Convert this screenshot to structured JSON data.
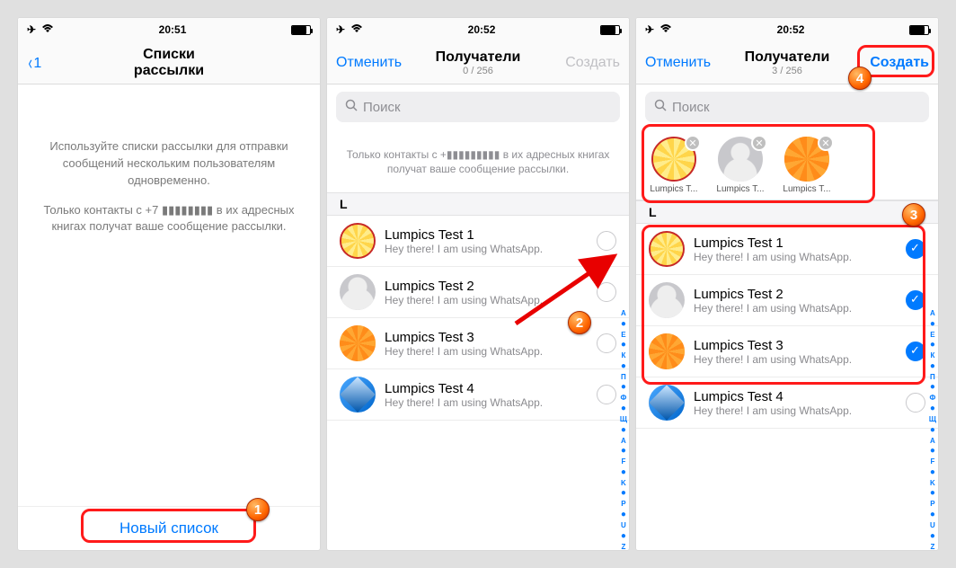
{
  "status": {
    "time1": "20:51",
    "time2": "20:52",
    "time3": "20:52"
  },
  "screen1": {
    "back_label": "1",
    "title": "Списки рассылки",
    "intro1": "Используйте списки рассылки для отправки сообщений нескольким пользователям одновременно.",
    "intro2": "Только контакты с +7 ▮▮▮▮▮▮▮▮ в их адресных книгах получат ваше сообщение рассылки.",
    "new_list": "Новый список"
  },
  "screen2": {
    "cancel": "Отменить",
    "title": "Получатели",
    "count": "0 / 256",
    "create": "Создать",
    "search_placeholder": "Поиск",
    "info": "Только контакты с +▮▮▮▮▮▮▮▮▮ в их адресных книгах получат ваше сообщение рассылки.",
    "section": "L",
    "contacts": [
      {
        "name": "Lumpics Test 1",
        "sub": "Hey there! I am using WhatsApp.",
        "avatar": "yellow"
      },
      {
        "name": "Lumpics Test 2",
        "sub": "Hey there! I am using WhatsApp.",
        "avatar": "gray"
      },
      {
        "name": "Lumpics Test 3",
        "sub": "Hey there! I am using WhatsApp.",
        "avatar": "orange"
      },
      {
        "name": "Lumpics Test 4",
        "sub": "Hey there! I am using WhatsApp.",
        "avatar": "blue"
      }
    ],
    "index": [
      "А",
      "●",
      "Е",
      "●",
      "К",
      "●",
      "П",
      "●",
      "Ф",
      "●",
      "Щ",
      "●",
      "A",
      "●",
      "F",
      "●",
      "K",
      "●",
      "P",
      "●",
      "U",
      "●",
      "Z",
      "#"
    ]
  },
  "screen3": {
    "cancel": "Отменить",
    "title": "Получатели",
    "count": "3 / 256",
    "create": "Создать",
    "search_placeholder": "Поиск",
    "selected": [
      {
        "label": "Lumpics T...",
        "avatar": "yellow"
      },
      {
        "label": "Lumpics T...",
        "avatar": "gray"
      },
      {
        "label": "Lumpics T...",
        "avatar": "orange"
      }
    ],
    "section": "L",
    "contacts": [
      {
        "name": "Lumpics Test 1",
        "sub": "Hey there! I am using WhatsApp.",
        "avatar": "yellow",
        "checked": true
      },
      {
        "name": "Lumpics Test 2",
        "sub": "Hey there! I am using WhatsApp.",
        "avatar": "gray",
        "checked": true
      },
      {
        "name": "Lumpics Test 3",
        "sub": "Hey there! I am using WhatsApp.",
        "avatar": "orange",
        "checked": true
      },
      {
        "name": "Lumpics Test 4",
        "sub": "Hey there! I am using WhatsApp.",
        "avatar": "blue",
        "checked": false
      }
    ],
    "index": [
      "А",
      "●",
      "Е",
      "●",
      "К",
      "●",
      "П",
      "●",
      "Ф",
      "●",
      "Щ",
      "●",
      "A",
      "●",
      "F",
      "●",
      "K",
      "●",
      "P",
      "●",
      "U",
      "●",
      "Z",
      "#"
    ]
  },
  "callouts": {
    "c1": "1",
    "c2": "2",
    "c3": "3",
    "c4": "4"
  }
}
